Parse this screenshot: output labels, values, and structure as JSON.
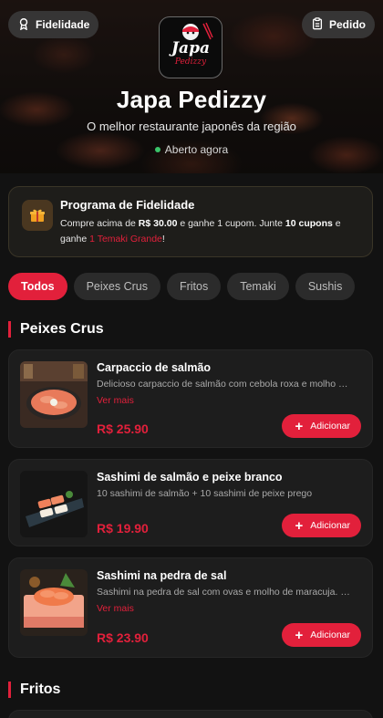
{
  "header": {
    "loyalty_button": "Fidelidade",
    "order_button": "Pedido",
    "logo_text": "Japa",
    "logo_sub": "Pedizzy",
    "title": "Japa Pedizzy",
    "subtitle": "O melhor restaurante japonês da região",
    "status": "Aberto agora"
  },
  "loyalty": {
    "title": "Programa de Fidelidade",
    "text_1": "Compre acima de ",
    "amount": "R$ 30.00",
    "text_2": " e ganhe 1 cupom. Junte ",
    "coupons": "10 cupons",
    "text_3": " e ganhe ",
    "reward": "1 Temaki Grande",
    "text_4": "!"
  },
  "tabs": [
    {
      "label": "Todos",
      "active": true
    },
    {
      "label": "Peixes Crus",
      "active": false
    },
    {
      "label": "Fritos",
      "active": false
    },
    {
      "label": "Temaki",
      "active": false
    },
    {
      "label": "Sushis",
      "active": false
    }
  ],
  "sections": [
    {
      "title": "Peixes Crus",
      "items": [
        {
          "name": "Carpaccio de salmão",
          "description": "Delicioso carpaccio de salmão com cebola roxa e molho esp...",
          "more": "Ver mais",
          "price": "R$ 25.90",
          "add_label": "Adicionar"
        },
        {
          "name": "Sashimi de salmão e peixe branco",
          "description": "10 sashimi de salmão + 10 sashimi de peixe prego",
          "more": "",
          "price": "R$ 19.90",
          "add_label": "Adicionar"
        },
        {
          "name": "Sashimi na pedra de sal",
          "description": "Sashimi na pedra de sal com ovas e molho de maracuja. 12 ...",
          "more": "Ver mais",
          "price": "R$ 23.90",
          "add_label": "Adicionar"
        }
      ]
    },
    {
      "title": "Fritos",
      "items": []
    }
  ],
  "colors": {
    "accent": "#e2203b",
    "background": "#121212",
    "card": "#1d1d1d",
    "status_dot": "#3ac46a"
  },
  "icons": {
    "loyalty": "award-icon",
    "order": "clipboard-icon",
    "gift": "gift-icon",
    "plus": "plus-icon"
  }
}
